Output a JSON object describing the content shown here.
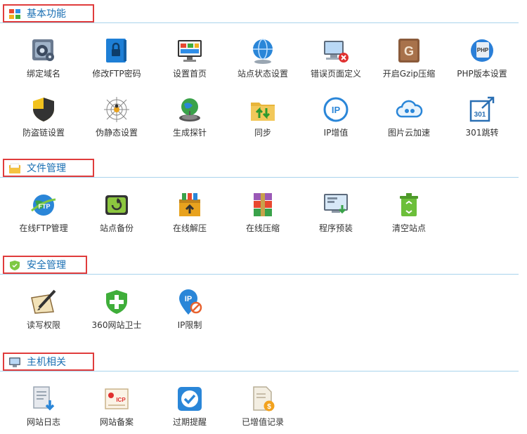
{
  "sections": [
    {
      "title": "基本功能",
      "items": [
        {
          "label": "绑定域名"
        },
        {
          "label": "修改FTP密码"
        },
        {
          "label": "设置首页"
        },
        {
          "label": "站点状态设置"
        },
        {
          "label": "错误页面定义"
        },
        {
          "label": "开启Gzip压缩"
        },
        {
          "label": "PHP版本设置"
        },
        {
          "label": "防盗链设置"
        },
        {
          "label": "伪静态设置"
        },
        {
          "label": "生成探针"
        },
        {
          "label": "同步"
        },
        {
          "label": "IP增值"
        },
        {
          "label": "图片云加速"
        },
        {
          "label": "301跳转"
        }
      ]
    },
    {
      "title": "文件管理",
      "items": [
        {
          "label": "在线FTP管理"
        },
        {
          "label": "站点备份"
        },
        {
          "label": "在线解压"
        },
        {
          "label": "在线压缩"
        },
        {
          "label": "程序预装"
        },
        {
          "label": "清空站点"
        }
      ]
    },
    {
      "title": "安全管理",
      "items": [
        {
          "label": "读写权限"
        },
        {
          "label": "360网站卫士"
        },
        {
          "label": "IP限制"
        }
      ]
    },
    {
      "title": "主机相关",
      "items": [
        {
          "label": "网站日志"
        },
        {
          "label": "网站备案"
        },
        {
          "label": "过期提醒"
        },
        {
          "label": "已增值记录"
        }
      ]
    }
  ],
  "icon_badges": {
    "php": "PHP",
    "ip": "IP",
    "redirect": "301",
    "gzip": "G",
    "icp": "ICP",
    "ftp": "FTP",
    "currency": "$"
  },
  "colors": {
    "accent_blue": "#1a6fb3",
    "highlight_red": "#e03c3c",
    "divider": "#a9d3ec"
  }
}
